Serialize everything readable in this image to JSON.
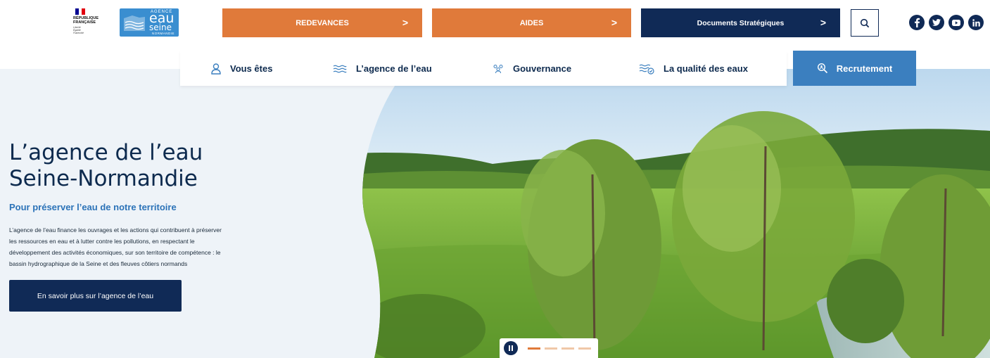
{
  "header": {
    "republique": [
      "RÉPUBLIQUE",
      "FRANÇAISE"
    ],
    "motto": [
      "Liberté",
      "Égalité",
      "Fraternité"
    ],
    "logo": {
      "small": "AGENCE",
      "eau": "eau",
      "seine": "seine",
      "region": "NORMANDIE"
    },
    "buttons": {
      "redevances": "REDEVANCES",
      "aides": "AIDES",
      "documents": "Documents Stratégiques",
      "chevron": ">"
    },
    "social": [
      "facebook-icon",
      "twitter-icon",
      "youtube-icon",
      "linkedin-icon"
    ]
  },
  "nav": {
    "items": [
      {
        "label": "Vous êtes",
        "icon": "user-icon"
      },
      {
        "label": "L’agence de l’eau",
        "icon": "waves-icon"
      },
      {
        "label": "Gouvernance",
        "icon": "people-icon"
      },
      {
        "label": "La qualité des eaux",
        "icon": "water-check-icon"
      }
    ],
    "recrutement": "Recrutement"
  },
  "hero": {
    "title_line1": "L’agence de l’eau",
    "title_line2": "Seine-Normandie",
    "subtitle": "Pour préserver l’eau de notre territoire",
    "description_lines": [
      "L’agence de l’eau finance les ouvrages et les actions qui contribuent à préserver",
      "les ressources en eau et à lutter contre les pollutions, en respectant le",
      "développement des activités économiques, sur son territoire de compétence : le",
      "bassin hydrographique de la Seine et des fleuves côtiers normands"
    ],
    "cta": "En savoir plus sur l’agence de l’eau",
    "slider": {
      "slides": 4,
      "active": 1
    }
  },
  "colors": {
    "navy": "#102a56",
    "orange": "#e07a3a",
    "blue": "#3b7fbf",
    "hero_bg": "#eef3f8"
  }
}
